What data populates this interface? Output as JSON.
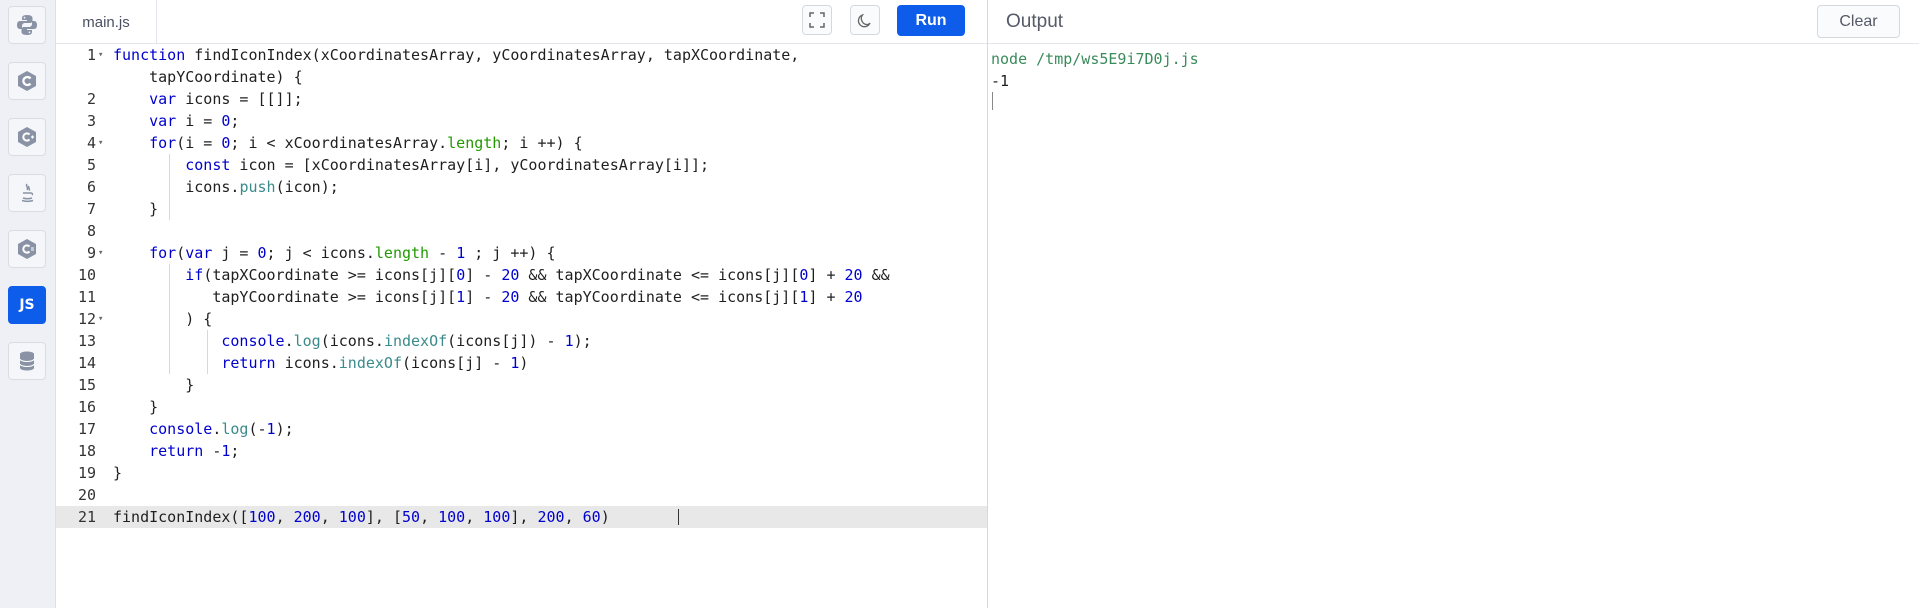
{
  "sidebar": {
    "languages": [
      {
        "icon": "python-icon",
        "name": "Python"
      },
      {
        "icon": "c-icon",
        "name": "C"
      },
      {
        "icon": "cpp-icon",
        "name": "C++"
      },
      {
        "icon": "java-icon",
        "name": "Java"
      },
      {
        "icon": "csharp-icon",
        "name": "C#"
      },
      {
        "icon": "js-icon",
        "label": "JS",
        "active": true
      },
      {
        "icon": "database-icon",
        "name": "SQL"
      }
    ]
  },
  "editor": {
    "file_tab": "main.js",
    "run_label": "Run",
    "fullscreen_icon": "fullscreen-icon",
    "theme_icon": "moon-icon",
    "lines": [
      {
        "num": "1",
        "fold": true,
        "text": "function findIconIndex(xCoordinatesArray, yCoordinatesArray, tapXCoordinate,"
      },
      {
        "num": "",
        "fold": false,
        "text": "    tapYCoordinate) {"
      },
      {
        "num": "2",
        "fold": false,
        "text": "    var icons = [[]];"
      },
      {
        "num": "3",
        "fold": false,
        "text": "    var i = 0;"
      },
      {
        "num": "4",
        "fold": true,
        "text": "    for(i = 0; i < xCoordinatesArray.length; i ++) {"
      },
      {
        "num": "5",
        "fold": false,
        "text": "        const icon = [xCoordinatesArray[i], yCoordinatesArray[i]];"
      },
      {
        "num": "6",
        "fold": false,
        "text": "        icons.push(icon);"
      },
      {
        "num": "7",
        "fold": false,
        "text": "    }"
      },
      {
        "num": "8",
        "fold": false,
        "text": ""
      },
      {
        "num": "9",
        "fold": true,
        "text": "    for(var j = 0; j < icons.length - 1 ; j ++) {"
      },
      {
        "num": "10",
        "fold": false,
        "text": "        if(tapXCoordinate >= icons[j][0] - 20 && tapXCoordinate <= icons[j][0] + 20 &&"
      },
      {
        "num": "11",
        "fold": false,
        "text": "           tapYCoordinate >= icons[j][1] - 20 && tapYCoordinate <= icons[j][1] + 20"
      },
      {
        "num": "12",
        "fold": true,
        "text": "        ) {"
      },
      {
        "num": "13",
        "fold": false,
        "text": "            console.log(icons.indexOf(icons[j]) - 1);"
      },
      {
        "num": "14",
        "fold": false,
        "text": "            return icons.indexOf(icons[j] - 1)"
      },
      {
        "num": "15",
        "fold": false,
        "text": "        }"
      },
      {
        "num": "16",
        "fold": false,
        "text": "    }"
      },
      {
        "num": "17",
        "fold": false,
        "text": "    console.log(-1);"
      },
      {
        "num": "18",
        "fold": false,
        "text": "    return -1;"
      },
      {
        "num": "19",
        "fold": false,
        "text": "}"
      },
      {
        "num": "20",
        "fold": false,
        "text": ""
      },
      {
        "num": "21",
        "fold": false,
        "text": "findIconIndex([100, 200, 100], [50, 100, 100], 200, 60)",
        "active": true
      }
    ]
  },
  "output": {
    "title": "Output",
    "clear_label": "Clear",
    "command": "node /tmp/ws5E9i7D0j.js",
    "result": "-1"
  }
}
